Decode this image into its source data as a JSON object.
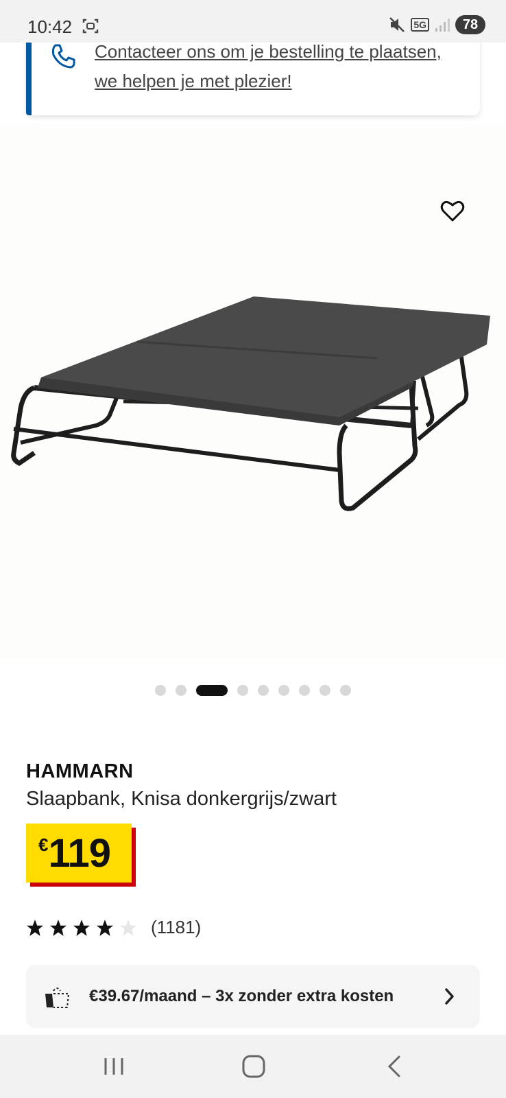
{
  "status_bar": {
    "time": "10:42",
    "network": "5G",
    "battery": "78"
  },
  "contact_banner": {
    "text": "Contacteer ons om je bestelling te plaatsen, we helpen je met plezier!",
    "accent_color": "#0058a3",
    "icon": "phone-icon"
  },
  "gallery": {
    "image_subject": "Grey fold-out sleeper bed on a black metal frame",
    "dot_count": 9,
    "active_dot_index": 2,
    "favorite_icon": "heart-icon"
  },
  "product": {
    "name": "HAMMARN",
    "description": "Slaapbank, Knisa donkergrijs/zwart",
    "price_currency": "€",
    "price_value": "119",
    "price_colors": {
      "background": "#ffdb00",
      "shadow": "#cc0008"
    }
  },
  "rating": {
    "stars": 4,
    "max_stars": 5,
    "count_label": "(1181)"
  },
  "payment": {
    "text": "€39.67/maand – 3x zonder extra kosten",
    "icon": "installment-icon",
    "chevron": "chevron-right-icon"
  },
  "nav_bar": {
    "buttons": [
      "recent-apps-icon",
      "home-icon",
      "back-icon"
    ]
  }
}
